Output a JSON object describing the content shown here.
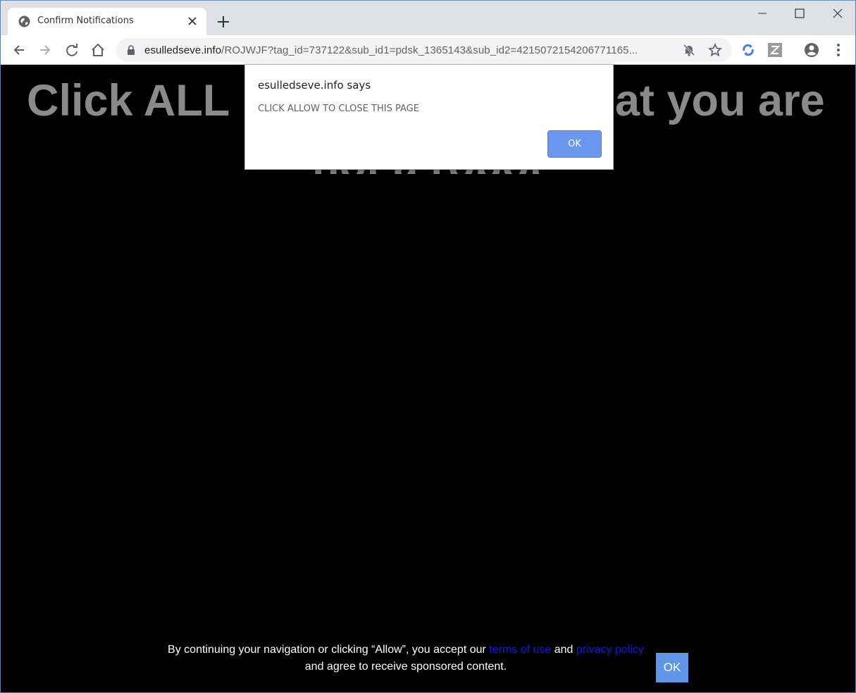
{
  "browser": {
    "tab_title": "Confirm Notifications",
    "url_host": "esulledseve.info",
    "url_path": "/ROJWJF?tag_id=737122&sub_id1=pdsk_1365143&sub_id2=4215072154206771165..."
  },
  "page": {
    "headline_left": "Click ALL",
    "headline_right": "at you are",
    "headline_line2": "not a robot"
  },
  "dialog": {
    "title": "esulledseve.info says",
    "message": "CLICK ALLOW TO CLOSE THIS PAGE",
    "ok_label": "OK"
  },
  "footer": {
    "text_before": "By continuing your navigation or clicking “Allow”, you accept our ",
    "terms_link": "terms of use",
    "text_and": " and ",
    "privacy_link": "privacy policy",
    "text_after": " and agree to receive sponsored content.",
    "ok_label": "OK"
  },
  "colors": {
    "dialog_button": "#6a98f0",
    "footer_button": "#5f95e6",
    "link": "#1515e0",
    "headline": "#8a8a8a"
  }
}
